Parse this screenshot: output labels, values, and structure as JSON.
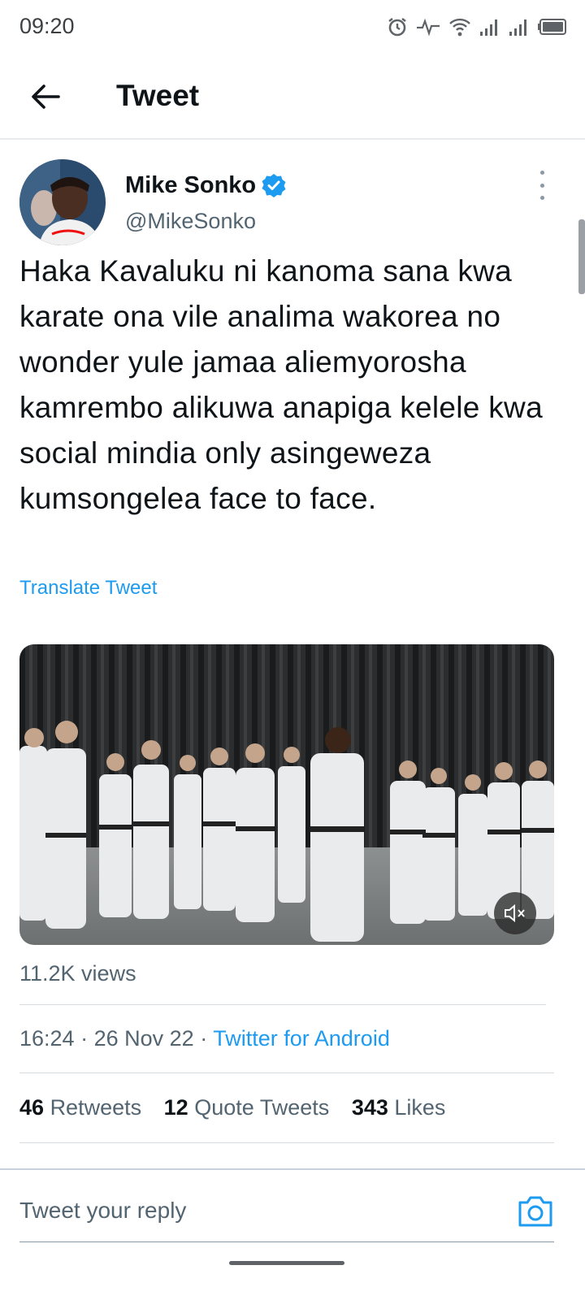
{
  "status_bar": {
    "time": "09:20"
  },
  "app_bar": {
    "title": "Tweet"
  },
  "tweet": {
    "author_name": "Mike Sonko",
    "author_handle": "@MikeSonko",
    "text": "Haka Kavaluku ni kanoma sana kwa karate ona vile analima wakorea no wonder yule jamaa aliemyorosha kamrembo alikuwa anapiga kelele kwa social mindia only asingeweza kumsongelea face to face.",
    "translate_label": "Translate Tweet",
    "views": "11.2K views",
    "time": "16:24",
    "date": "26 Nov 22",
    "source": "Twitter for Android",
    "separator": "·",
    "retweets_count": "46",
    "retweets_label": "Retweets",
    "quotes_count": "12",
    "quotes_label": "Quote Tweets",
    "likes_count": "343",
    "likes_label": "Likes"
  },
  "reply": {
    "placeholder": "Tweet your reply"
  },
  "icons": {
    "back": "arrow-left-icon",
    "verified": "verified-badge-icon",
    "more": "more-vertical-icon",
    "mute": "volume-muted-icon",
    "camera": "camera-icon"
  },
  "colors": {
    "accent": "#1d9bf0",
    "text": "#0f1419",
    "secondary": "#536471"
  }
}
